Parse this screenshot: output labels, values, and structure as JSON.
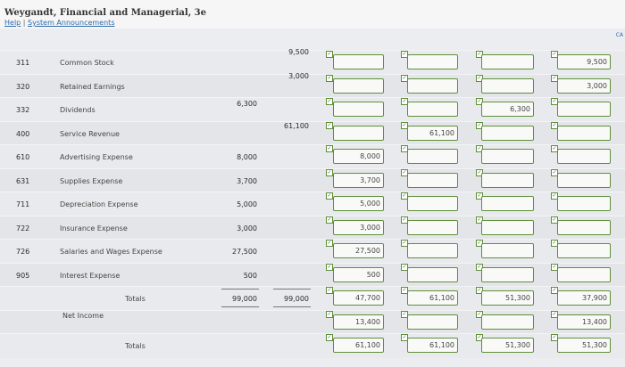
{
  "header": {
    "title": "Weygandt, Financial and Managerial, 3e",
    "help": "Help",
    "sep": "|",
    "announcements": "System Announcements",
    "corner": "CA"
  },
  "rows": [
    {
      "code": "311",
      "name": "Common Stock",
      "tb_dr": "",
      "tb_cr": "9,500",
      "is_dr": "",
      "is_cr": "",
      "bs_dr": "",
      "bs_cr": "9,500"
    },
    {
      "code": "320",
      "name": "Retained Earnings",
      "tb_dr": "",
      "tb_cr": "3,000",
      "is_dr": "",
      "is_cr": "",
      "bs_dr": "",
      "bs_cr": "3,000"
    },
    {
      "code": "332",
      "name": "Dividends",
      "tb_dr": "6,300",
      "tb_cr": "",
      "is_dr": "",
      "is_cr": "",
      "bs_dr": "6,300",
      "bs_cr": ""
    },
    {
      "code": "400",
      "name": "Service Revenue",
      "tb_dr": "",
      "tb_cr": "61,100",
      "is_dr": "",
      "is_cr": "61,100",
      "bs_dr": "",
      "bs_cr": ""
    },
    {
      "code": "610",
      "name": "Advertising Expense",
      "tb_dr": "8,000",
      "tb_cr": "",
      "is_dr": "8,000",
      "is_cr": "",
      "bs_dr": "",
      "bs_cr": ""
    },
    {
      "code": "631",
      "name": "Supplies Expense",
      "tb_dr": "3,700",
      "tb_cr": "",
      "is_dr": "3,700",
      "is_cr": "",
      "bs_dr": "",
      "bs_cr": ""
    },
    {
      "code": "711",
      "name": "Depreciation Expense",
      "tb_dr": "5,000",
      "tb_cr": "",
      "is_dr": "5,000",
      "is_cr": "",
      "bs_dr": "",
      "bs_cr": ""
    },
    {
      "code": "722",
      "name": "Insurance Expense",
      "tb_dr": "3,000",
      "tb_cr": "",
      "is_dr": "3,000",
      "is_cr": "",
      "bs_dr": "",
      "bs_cr": ""
    },
    {
      "code": "726",
      "name": "Salaries and Wages Expense",
      "tb_dr": "27,500",
      "tb_cr": "",
      "is_dr": "27,500",
      "is_cr": "",
      "bs_dr": "",
      "bs_cr": ""
    },
    {
      "code": "905",
      "name": "Interest Expense",
      "tb_dr": "500",
      "tb_cr": "",
      "is_dr": "500",
      "is_cr": "",
      "bs_dr": "",
      "bs_cr": ""
    },
    {
      "code": "",
      "name": "Totals",
      "tb_dr": "99,000",
      "tb_cr": "99,000",
      "is_dr": "47,700",
      "is_cr": "61,100",
      "bs_dr": "51,300",
      "bs_cr": "37,900"
    },
    {
      "code": "",
      "name": "Net Income",
      "tb_dr": "",
      "tb_cr": "",
      "is_dr": "13,400",
      "is_cr": "",
      "bs_dr": "",
      "bs_cr": "13,400"
    },
    {
      "code": "",
      "name": "Totals",
      "tb_dr": "",
      "tb_cr": "",
      "is_dr": "61,100",
      "is_cr": "61,100",
      "bs_dr": "51,300",
      "bs_cr": "51,300"
    }
  ]
}
